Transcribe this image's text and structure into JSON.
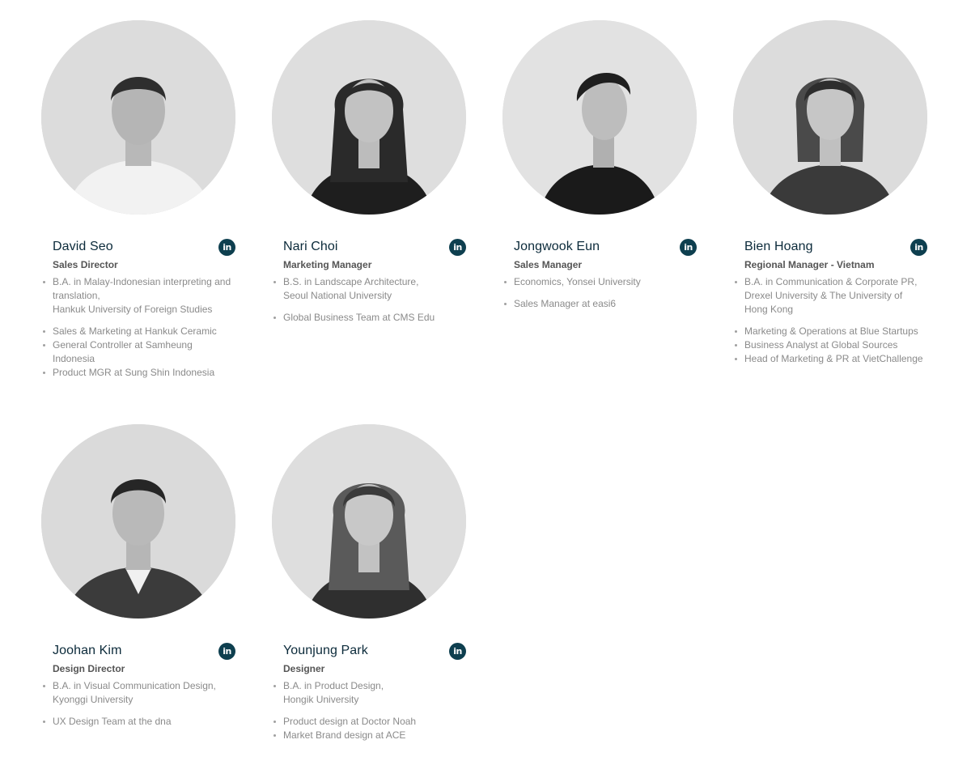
{
  "members": [
    {
      "name": "David Seo",
      "role": "Sales Director",
      "education": [
        "B.A. in Malay-Indonesian interpreting and translation,",
        "Hankuk University of Foreign Studies"
      ],
      "experience": [
        "Sales & Marketing at Hankuk Ceramic",
        "General Controller at Samheung Indonesia",
        "Product MGR at Sung Shin Indonesia"
      ],
      "linkedin_label": "in"
    },
    {
      "name": "Nari Choi",
      "role": "Marketing Manager",
      "education": [
        "B.S. in Landscape Architecture,",
        "Seoul National University"
      ],
      "experience": [
        "Global Business Team at CMS Edu"
      ],
      "linkedin_label": "in"
    },
    {
      "name": "Jongwook Eun",
      "role": "Sales Manager",
      "education": [
        "Economics, Yonsei University"
      ],
      "experience": [
        "Sales Manager at easi6"
      ],
      "linkedin_label": "in"
    },
    {
      "name": "Bien Hoang",
      "role": "Regional Manager - Vietnam",
      "education": [
        "B.A. in Communication & Corporate PR,",
        "Drexel University & The University of Hong Kong"
      ],
      "experience": [
        "Marketing & Operations at Blue Startups",
        "Business Analyst at Global Sources",
        "Head of Marketing & PR at VietChallenge"
      ],
      "linkedin_label": "in"
    },
    {
      "name": "Joohan Kim",
      "role": "Design Director",
      "education": [
        "B.A. in Visual Communication Design,",
        "Kyonggi University"
      ],
      "experience": [
        "UX Design Team at the dna"
      ],
      "linkedin_label": "in"
    },
    {
      "name": "Younjung Park",
      "role": "Designer",
      "education": [
        "B.A. in Product Design,",
        "Hongik University"
      ],
      "experience": [
        "Product design at Doctor Noah",
        "Market Brand design at ACE"
      ],
      "linkedin_label": "in"
    }
  ],
  "colors": {
    "name": "#0b2a3a",
    "role": "#555555",
    "info": "#8a8a8a",
    "linkedin_bg": "#0e3f4f"
  },
  "icons": {
    "linkedin": "linkedin-icon",
    "photo": "portrait-photo"
  }
}
